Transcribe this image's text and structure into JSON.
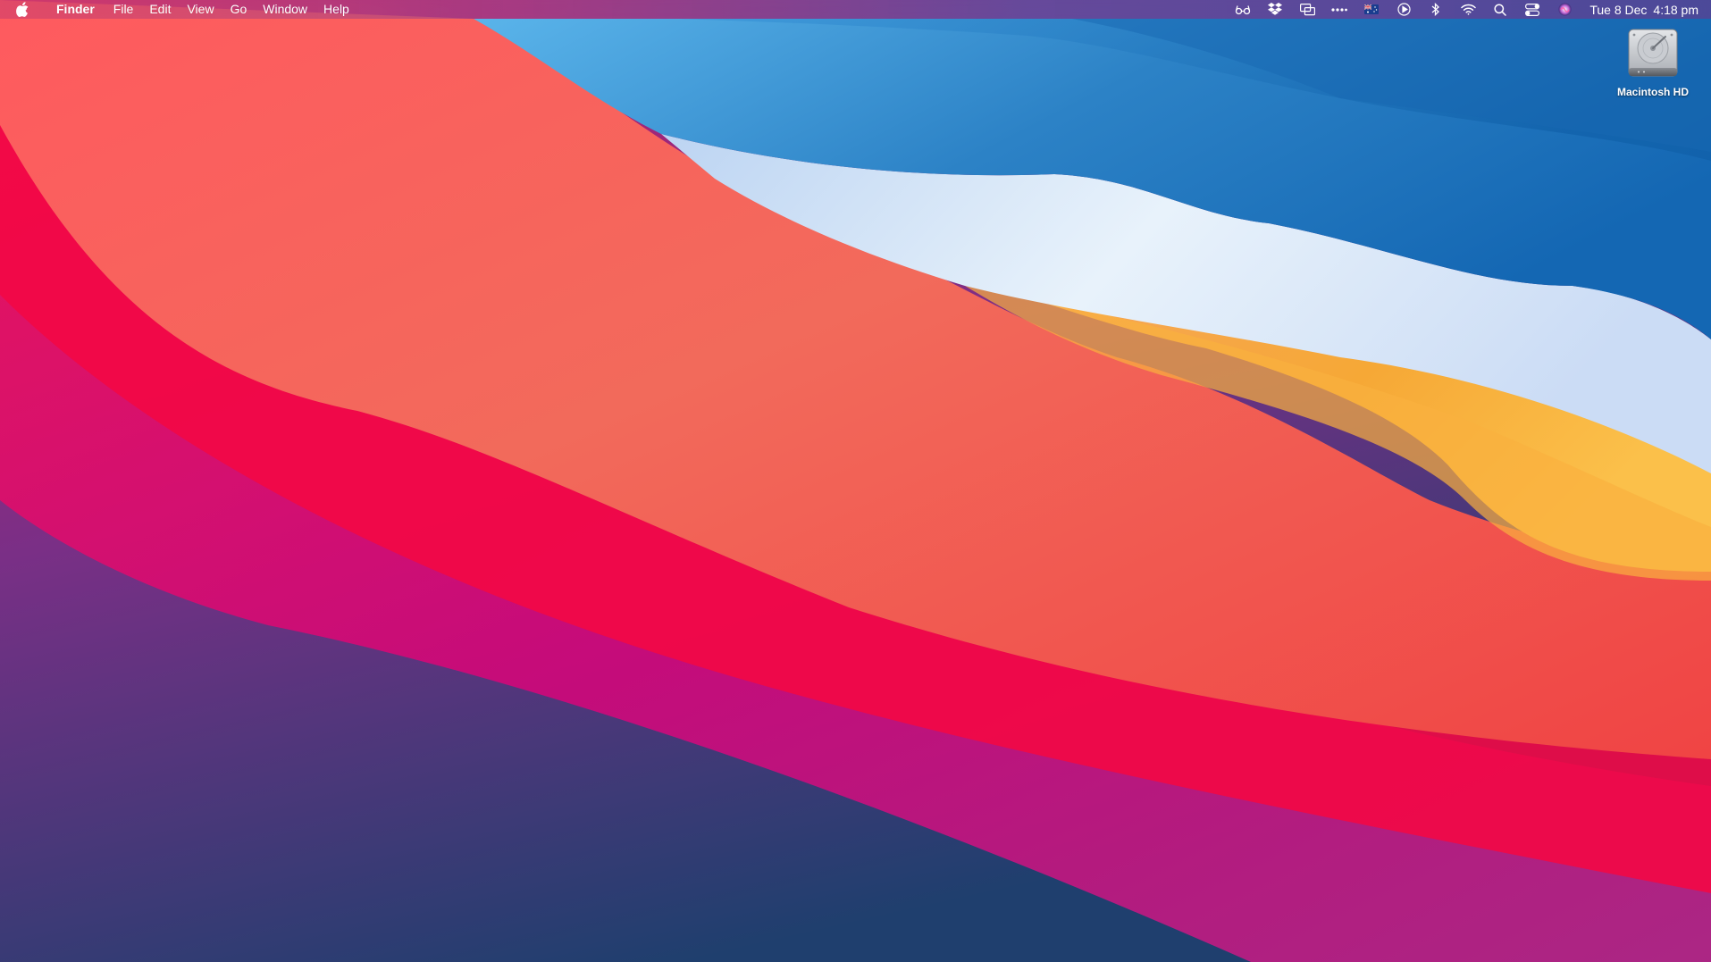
{
  "menubar": {
    "app_name": "Finder",
    "menus": [
      "File",
      "Edit",
      "View",
      "Go",
      "Window",
      "Help"
    ],
    "status_icons": [
      "reader-glasses-icon",
      "dropbox-icon",
      "screen-mirror-icon",
      "more-dots-icon",
      "input-flag-icon",
      "play-circle-icon",
      "bluetooth-icon",
      "wifi-icon",
      "spotlight-search-icon",
      "control-center-icon",
      "siri-icon"
    ],
    "clock_date": "Tue 8 Dec",
    "clock_time": "4:18 pm"
  },
  "desktop": {
    "icons": [
      {
        "label": "Macintosh HD",
        "icon": "hard-disk-icon"
      }
    ]
  },
  "colors": {
    "wallpaper_blue": "#1a6fba",
    "wallpaper_red": "#f2103f",
    "wallpaper_orange": "#f6a235",
    "wallpaper_purple": "#6a3a8a"
  }
}
